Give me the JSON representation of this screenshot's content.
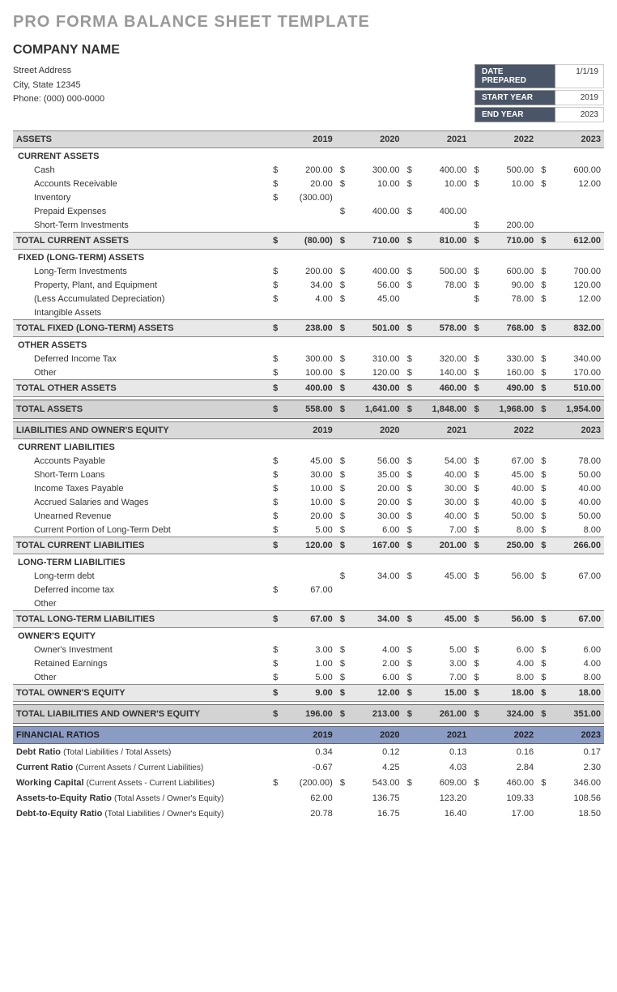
{
  "title": "PRO FORMA BALANCE SHEET TEMPLATE",
  "company": "COMPANY NAME",
  "addr": [
    "Street Address",
    "City, State  12345",
    "Phone: (000) 000-0000"
  ],
  "dates": [
    {
      "l": "DATE PREPARED",
      "v": "1/1/19"
    },
    {
      "l": "START YEAR",
      "v": "2019"
    },
    {
      "l": "END YEAR",
      "v": "2023"
    }
  ],
  "years": [
    "2019",
    "2020",
    "2021",
    "2022",
    "2023"
  ],
  "sections": [
    {
      "header": "ASSETS",
      "yearhead": true,
      "groups": [
        {
          "sub": "CURRENT ASSETS",
          "items": [
            {
              "n": "Cash",
              "v": [
                "200.00",
                "300.00",
                "400.00",
                "500.00",
                "600.00"
              ]
            },
            {
              "n": "Accounts Receivable",
              "v": [
                "20.00",
                "10.00",
                "10.00",
                "10.00",
                "12.00"
              ]
            },
            {
              "n": "Inventory",
              "v": [
                "(300.00)",
                "",
                "",
                "",
                ""
              ],
              "nosym": [
                false,
                true,
                true,
                true,
                true
              ]
            },
            {
              "n": "Prepaid Expenses",
              "v": [
                "",
                "400.00",
                "400.00",
                "",
                ""
              ],
              "nosym": [
                true,
                false,
                false,
                true,
                true
              ]
            },
            {
              "n": "Short-Term Investments",
              "v": [
                "",
                "",
                "",
                "200.00",
                ""
              ],
              "nosym": [
                true,
                true,
                true,
                false,
                true
              ]
            }
          ],
          "total": {
            "n": "TOTAL CURRENT ASSETS",
            "v": [
              "(80.00)",
              "710.00",
              "810.00",
              "710.00",
              "612.00"
            ]
          }
        },
        {
          "sub": "FIXED (LONG-TERM) ASSETS",
          "items": [
            {
              "n": "Long-Term Investments",
              "v": [
                "200.00",
                "400.00",
                "500.00",
                "600.00",
                "700.00"
              ]
            },
            {
              "n": "Property, Plant, and Equipment",
              "v": [
                "34.00",
                "56.00",
                "78.00",
                "90.00",
                "120.00"
              ]
            },
            {
              "n": "(Less Accumulated Depreciation)",
              "v": [
                "4.00",
                "45.00",
                "",
                "78.00",
                "12.00"
              ],
              "nosym": [
                false,
                false,
                true,
                false,
                false
              ]
            },
            {
              "n": "Intangible Assets",
              "v": [
                "",
                "",
                "",
                "",
                ""
              ],
              "nosym": [
                true,
                true,
                true,
                true,
                true
              ]
            }
          ],
          "total": {
            "n": "TOTAL FIXED (LONG-TERM) ASSETS",
            "v": [
              "238.00",
              "501.00",
              "578.00",
              "768.00",
              "832.00"
            ]
          }
        },
        {
          "sub": "OTHER ASSETS",
          "items": [
            {
              "n": "Deferred Income Tax",
              "v": [
                "300.00",
                "310.00",
                "320.00",
                "330.00",
                "340.00"
              ]
            },
            {
              "n": "Other",
              "v": [
                "100.00",
                "120.00",
                "140.00",
                "160.00",
                "170.00"
              ]
            }
          ],
          "total": {
            "n": "TOTAL OTHER ASSETS",
            "v": [
              "400.00",
              "430.00",
              "460.00",
              "490.00",
              "510.00"
            ]
          }
        }
      ],
      "grand": {
        "n": "TOTAL ASSETS",
        "v": [
          "558.00",
          "1,641.00",
          "1,848.00",
          "1,968.00",
          "1,954.00"
        ]
      }
    },
    {
      "header": "LIABILITIES AND OWNER'S EQUITY",
      "yearhead": true,
      "groups": [
        {
          "sub": "CURRENT LIABILITIES",
          "items": [
            {
              "n": "Accounts Payable",
              "v": [
                "45.00",
                "56.00",
                "54.00",
                "67.00",
                "78.00"
              ]
            },
            {
              "n": "Short-Term Loans",
              "v": [
                "30.00",
                "35.00",
                "40.00",
                "45.00",
                "50.00"
              ]
            },
            {
              "n": "Income Taxes Payable",
              "v": [
                "10.00",
                "20.00",
                "30.00",
                "40.00",
                "40.00"
              ]
            },
            {
              "n": "Accrued Salaries and Wages",
              "v": [
                "10.00",
                "20.00",
                "30.00",
                "40.00",
                "40.00"
              ]
            },
            {
              "n": "Unearned Revenue",
              "v": [
                "20.00",
                "30.00",
                "40.00",
                "50.00",
                "50.00"
              ]
            },
            {
              "n": "Current Portion of Long-Term Debt",
              "v": [
                "5.00",
                "6.00",
                "7.00",
                "8.00",
                "8.00"
              ]
            }
          ],
          "total": {
            "n": "TOTAL CURRENT LIABILITIES",
            "v": [
              "120.00",
              "167.00",
              "201.00",
              "250.00",
              "266.00"
            ]
          }
        },
        {
          "sub": "LONG-TERM LIABILITIES",
          "items": [
            {
              "n": "Long-term debt",
              "v": [
                "",
                "34.00",
                "45.00",
                "56.00",
                "67.00"
              ],
              "nosym": [
                true,
                false,
                false,
                false,
                false
              ]
            },
            {
              "n": "Deferred income tax",
              "v": [
                "67.00",
                "",
                "",
                "",
                ""
              ],
              "nosym": [
                false,
                true,
                true,
                true,
                true
              ]
            },
            {
              "n": "Other",
              "v": [
                "",
                "",
                "",
                "",
                ""
              ],
              "nosym": [
                true,
                true,
                true,
                true,
                true
              ]
            }
          ],
          "total": {
            "n": "TOTAL LONG-TERM LIABILITIES",
            "v": [
              "67.00",
              "34.00",
              "45.00",
              "56.00",
              "67.00"
            ]
          }
        },
        {
          "sub": "OWNER'S EQUITY",
          "items": [
            {
              "n": "Owner's Investment",
              "v": [
                "3.00",
                "4.00",
                "5.00",
                "6.00",
                "6.00"
              ]
            },
            {
              "n": "Retained Earnings",
              "v": [
                "1.00",
                "2.00",
                "3.00",
                "4.00",
                "4.00"
              ]
            },
            {
              "n": "Other",
              "v": [
                "5.00",
                "6.00",
                "7.00",
                "8.00",
                "8.00"
              ]
            }
          ],
          "total": {
            "n": "TOTAL OWNER'S EQUITY",
            "v": [
              "9.00",
              "12.00",
              "15.00",
              "18.00",
              "18.00"
            ]
          }
        }
      ],
      "grand": {
        "n": "TOTAL LIABILITIES AND OWNER'S EQUITY",
        "v": [
          "196.00",
          "213.00",
          "261.00",
          "324.00",
          "351.00"
        ]
      }
    }
  ],
  "ratios": {
    "header": "FINANCIAL RATIOS",
    "rows": [
      {
        "n": "Debt Ratio",
        "d": "(Total Liabilities / Total Assets)",
        "v": [
          "0.34",
          "0.12",
          "0.13",
          "0.16",
          "0.17"
        ]
      },
      {
        "n": "Current Ratio",
        "d": "(Current Assets / Current Liabilities)",
        "v": [
          "-0.67",
          "4.25",
          "4.03",
          "2.84",
          "2.30"
        ]
      },
      {
        "n": "Working Capital",
        "d": "(Current Assets - Current Liabilities)",
        "v": [
          "(200.00)",
          "543.00",
          "609.00",
          "460.00",
          "346.00"
        ],
        "sym": true
      },
      {
        "n": "Assets-to-Equity Ratio",
        "d": "(Total Assets / Owner's Equity)",
        "v": [
          "62.00",
          "136.75",
          "123.20",
          "109.33",
          "108.56"
        ]
      },
      {
        "n": "Debt-to-Equity Ratio",
        "d": "(Total Liabilities / Owner's Equity)",
        "v": [
          "20.78",
          "16.75",
          "16.40",
          "17.00",
          "18.50"
        ]
      }
    ]
  }
}
